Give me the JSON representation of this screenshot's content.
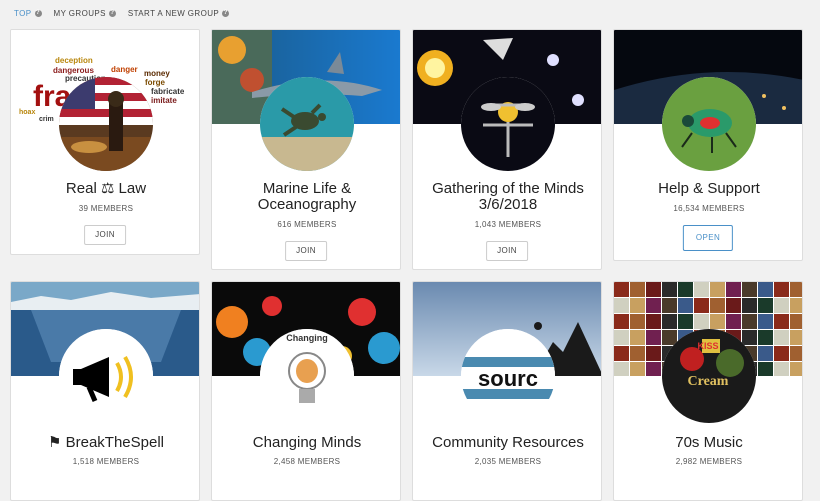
{
  "nav": {
    "items": [
      {
        "label": "TOP"
      },
      {
        "label": "MY GROUPS"
      },
      {
        "label": "START A NEW GROUP"
      }
    ]
  },
  "groups": [
    {
      "name": "Real ⚖ Law",
      "members": "39 MEMBERS",
      "action": "JOIN"
    },
    {
      "name": "Marine Life & Oceanography",
      "members": "616 MEMBERS",
      "action": "JOIN"
    },
    {
      "name": "Gathering of the Minds 3/6/2018",
      "members": "1,043 MEMBERS",
      "action": "JOIN"
    },
    {
      "name": "Help & Support",
      "members": "16,534 MEMBERS",
      "action": "OPEN"
    },
    {
      "name": "BreakTheSpell",
      "members": "1,518 MEMBERS"
    },
    {
      "name": "Changing Minds",
      "members": "2,458 MEMBERS"
    },
    {
      "name": "Community Resources",
      "members": "2,035 MEMBERS"
    },
    {
      "name": "70s Music",
      "members": "2,982 MEMBERS"
    }
  ],
  "avatar_text": {
    "law_words": [
      "deception",
      "dangerous",
      "danger",
      "money",
      "precaution",
      "forge",
      "fabricate",
      "imitate",
      "hoax",
      "crim",
      "fraud"
    ],
    "changing": "Changing",
    "source": "sourc",
    "music": [
      "KISS",
      "Cream"
    ]
  },
  "colors": {
    "accent": "#4a90c8",
    "text": "#222222",
    "muted": "#555555"
  }
}
